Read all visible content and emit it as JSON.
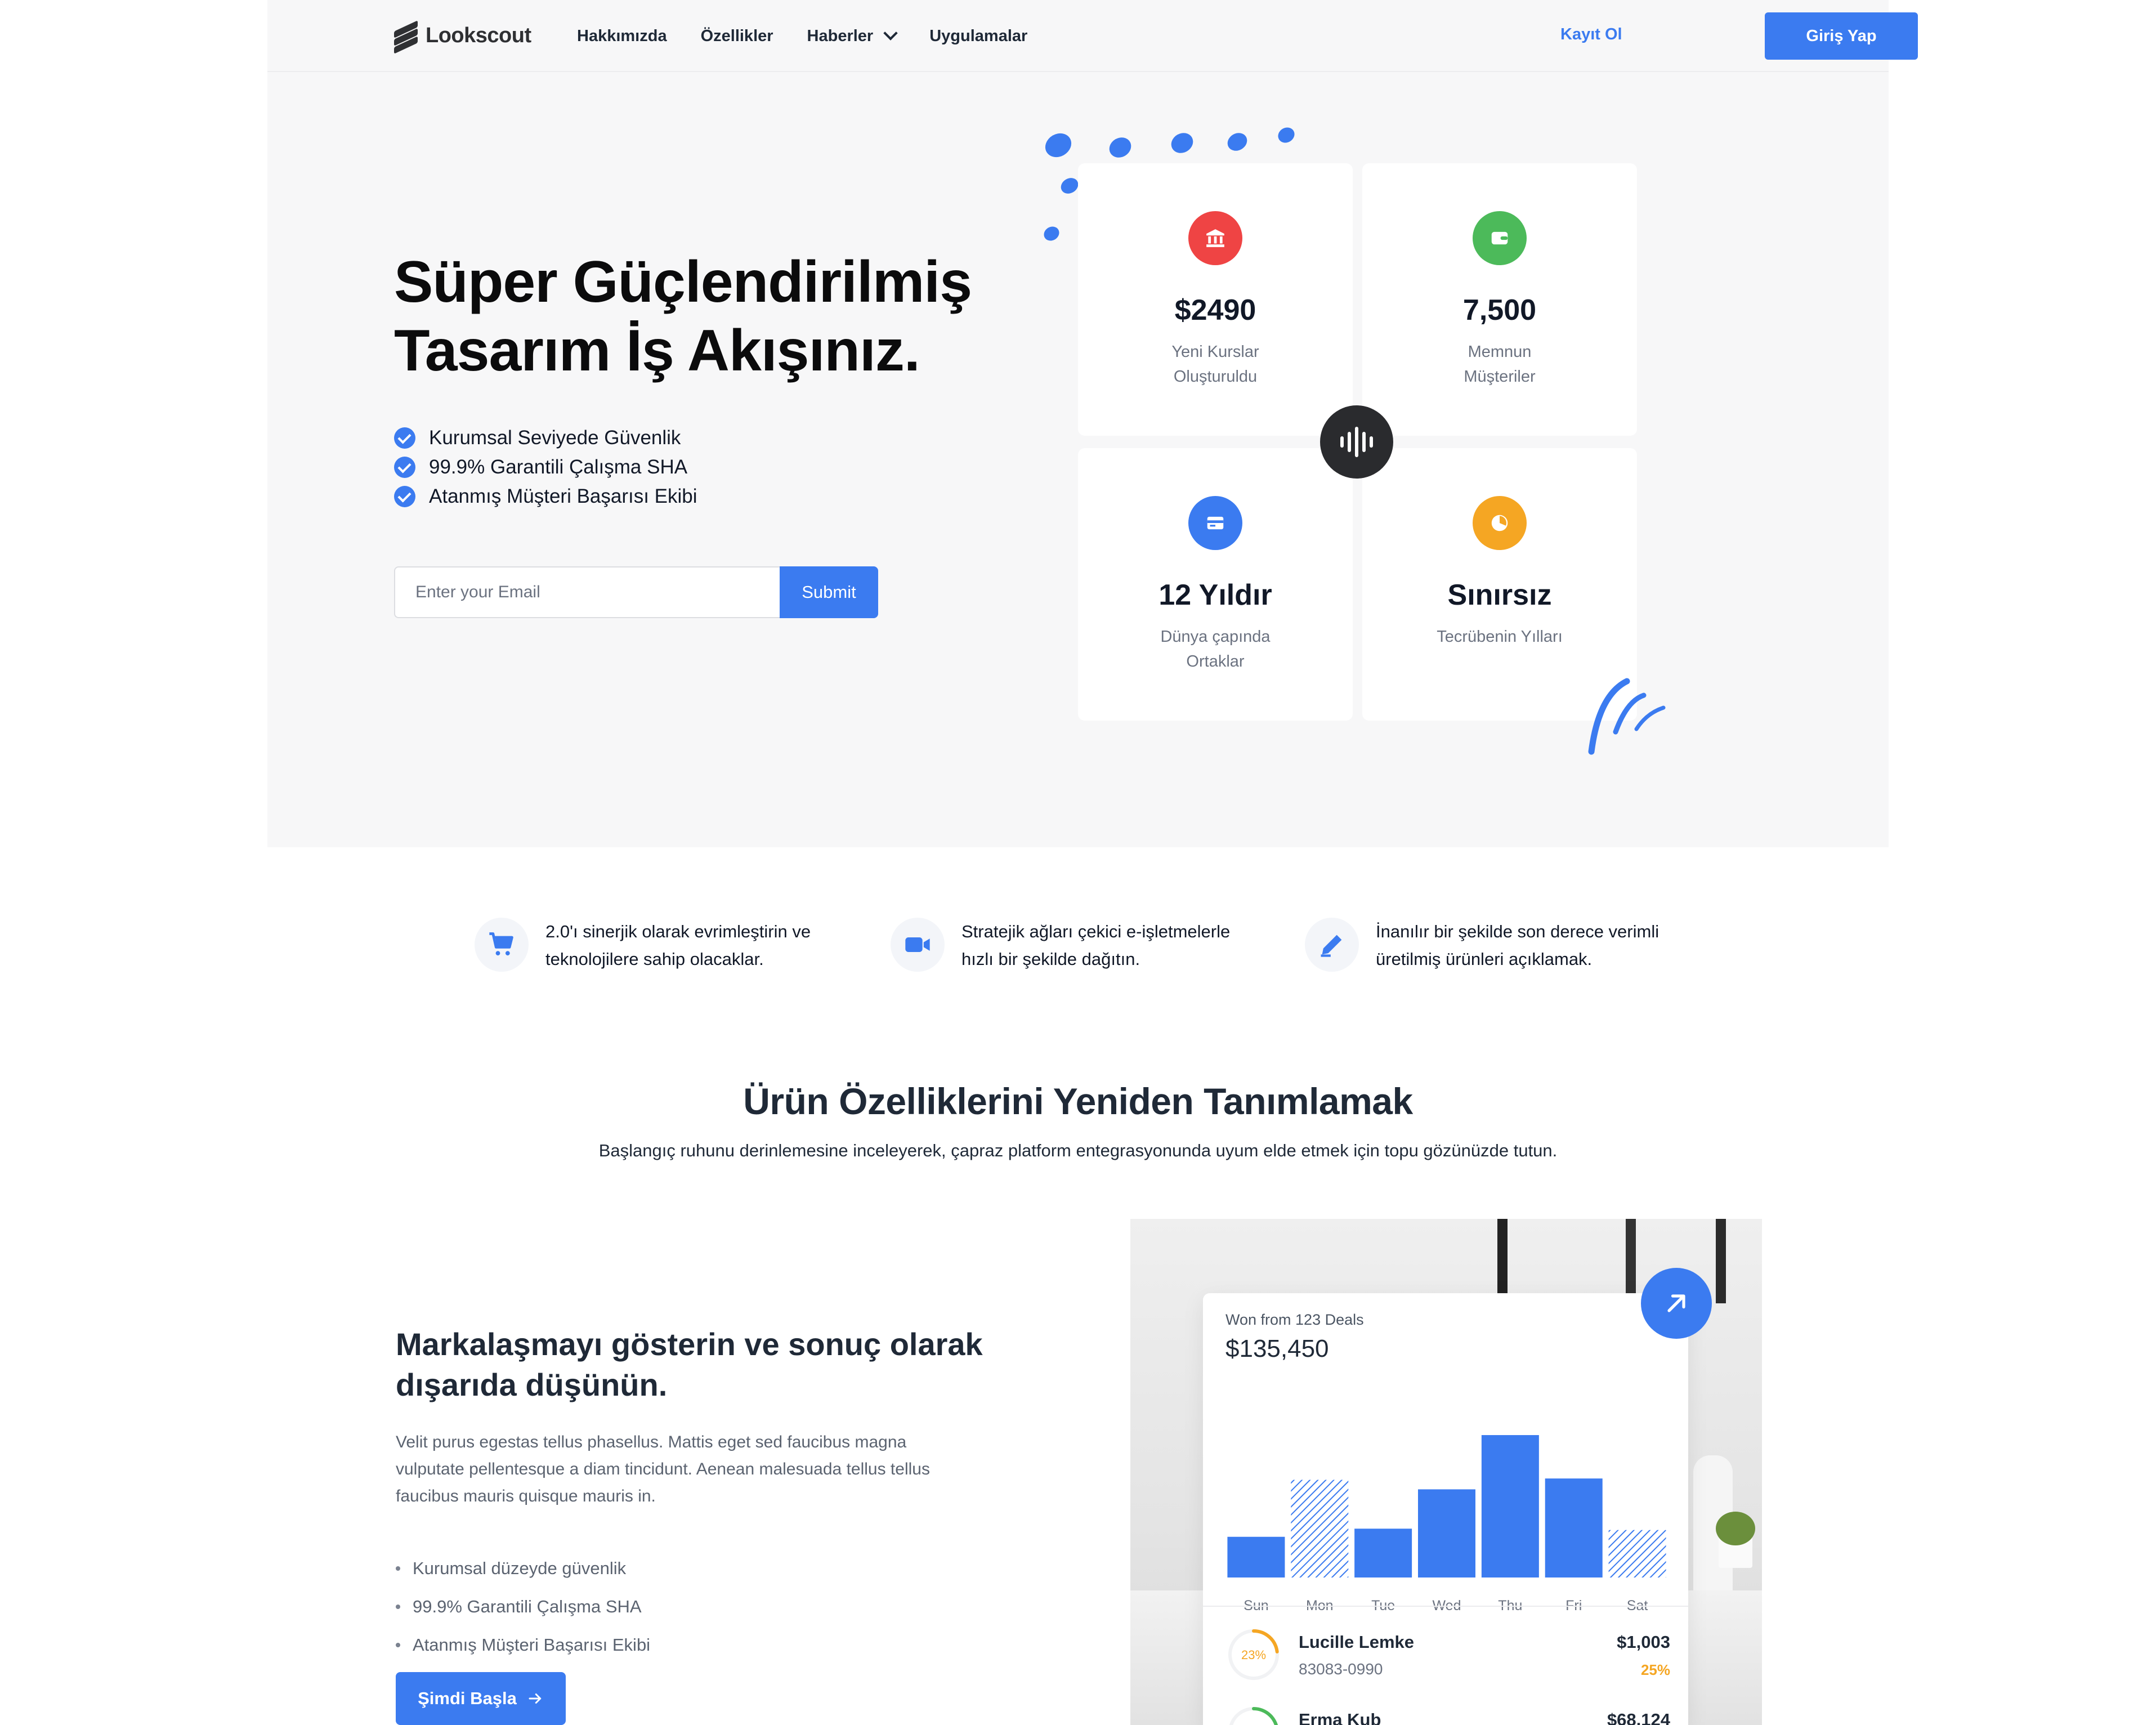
{
  "nav": {
    "logo": "Lookscout",
    "links": [
      "Hakkımızda",
      "Özellikler",
      "Haberler",
      "Uygulamalar"
    ],
    "register": "Kayıt Ol",
    "login": "Giriş Yap"
  },
  "hero": {
    "title_line1": "Süper Güçlendirilmiş",
    "title_line2": "Tasarım İş Akışınız.",
    "checks": [
      "Kurumsal Seviyede Güvenlik",
      "99.9% Garantili Çalışma SHA",
      "Atanmış Müşteri Başarısı Ekibi"
    ],
    "email_placeholder": "Enter your Email",
    "submit": "Submit"
  },
  "stats": [
    {
      "value": "$2490",
      "label": "Yeni Kurslar Oluşturuldu",
      "icon": "bank-icon",
      "color": "#ef4444"
    },
    {
      "value": "7,500",
      "label": "Memnun Müşteriler",
      "icon": "wallet-icon",
      "color": "#4cba5a"
    },
    {
      "value": "12 Yıldır",
      "label": "Dünya çapında Ortaklar",
      "icon": "card-icon",
      "color": "#3b7bf0"
    },
    {
      "value": "Sınırsız",
      "label": "Tecrübenin Yılları",
      "icon": "pie-chart-icon",
      "color": "#f5a623"
    }
  ],
  "features": [
    {
      "icon": "cart-icon",
      "text": "2.0'ı sinerjik olarak evrimleştirin ve teknolojilere sahip olacaklar."
    },
    {
      "icon": "video-icon",
      "text": "Stratejik ağları çekici e-işletmelerle hızlı bir şekilde dağıtın."
    },
    {
      "icon": "edit-icon",
      "text": "İnanılır bir şekilde son derece verimli üretilmiş ürünleri açıklamak."
    }
  ],
  "section": {
    "title": "Ürün Özelliklerini Yeniden Tanımlamak",
    "subtitle": "Başlangıç ruhunu derinlemesine inceleyerek, çapraz platform entegrasyonunda uyum elde etmek için topu gözünüzde tutun."
  },
  "brand": {
    "title_line1": "Markalaşmayı gösterin ve sonuç olarak",
    "title_line2": "dışarıda düşünün.",
    "description": "Velit purus egestas tellus phasellus. Mattis eget sed faucibus magna vulputate pellentesque a diam tincidunt. Aenean malesuada tellus tellus faucibus mauris quisque mauris in.",
    "bullets": [
      "Kurumsal düzeyde güvenlik",
      "99.9% Garantili Çalışma SHA",
      "Atanmış Müşteri Başarısı Ekibi"
    ],
    "cta": "Şimdi Başla"
  },
  "dashboard": {
    "subtitle": "Won from 123 Deals",
    "total": "$135,450",
    "rows": [
      {
        "name": "Lucille Lemke",
        "id": "83083-0990",
        "amount": "$1,003",
        "pct": "25%",
        "ring_label": "23%",
        "ring_value": 0.23,
        "ring_color": "#f5a623"
      },
      {
        "name": "Erma Kub",
        "id": "",
        "amount": "$68,124",
        "pct": "",
        "ring_label": "",
        "ring_value": 0.3,
        "ring_color": "#4cba5a"
      }
    ]
  },
  "chart_data": {
    "type": "bar",
    "categories": [
      "Sun",
      "Mon",
      "Tue",
      "Wed",
      "Thu",
      "Fri",
      "Sat"
    ],
    "values": [
      30,
      72,
      36,
      65,
      105,
      73,
      35
    ],
    "hatched": [
      false,
      true,
      false,
      false,
      false,
      false,
      true
    ],
    "ylim": [
      0,
      110
    ],
    "color": "#3b7bf0"
  }
}
